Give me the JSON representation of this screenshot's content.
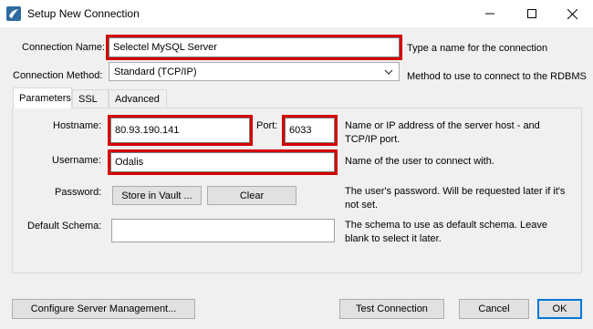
{
  "window": {
    "title": "Setup New Connection",
    "minimize_glyph": "—",
    "maximize_glyph": "☐",
    "close_glyph": "✕"
  },
  "connection_name": {
    "label": "Connection Name:",
    "value": "Selectel MySQL Server",
    "hint": "Type a name for the connection"
  },
  "connection_method": {
    "label": "Connection Method:",
    "selected": "Standard (TCP/IP)",
    "hint": "Method to use to connect to the RDBMS"
  },
  "tabs": [
    {
      "label": "Parameters",
      "active": true
    },
    {
      "label": "SSL",
      "active": false
    },
    {
      "label": "Advanced",
      "active": false
    }
  ],
  "parameters": {
    "hostname": {
      "label": "Hostname:",
      "value": "80.93.190.141"
    },
    "port": {
      "label": "Port:",
      "value": "6033"
    },
    "hostname_hint": "Name or IP address of the server host - and TCP/IP port.",
    "username": {
      "label": "Username:",
      "value": "Odalis",
      "hint": "Name of the user to connect with."
    },
    "password": {
      "label": "Password:",
      "store_button": "Store in Vault ...",
      "clear_button": "Clear",
      "hint": "The user's password. Will be requested later if it's not set."
    },
    "default_schema": {
      "label": "Default Schema:",
      "value": "",
      "hint": "The schema to use as default schema. Leave blank to select it later."
    }
  },
  "footer": {
    "configure_button": "Configure Server Management...",
    "test_button": "Test Connection",
    "cancel_button": "Cancel",
    "ok_button": "OK"
  },
  "colors": {
    "highlight": "#d40000",
    "default_button_border": "#0078d7"
  }
}
